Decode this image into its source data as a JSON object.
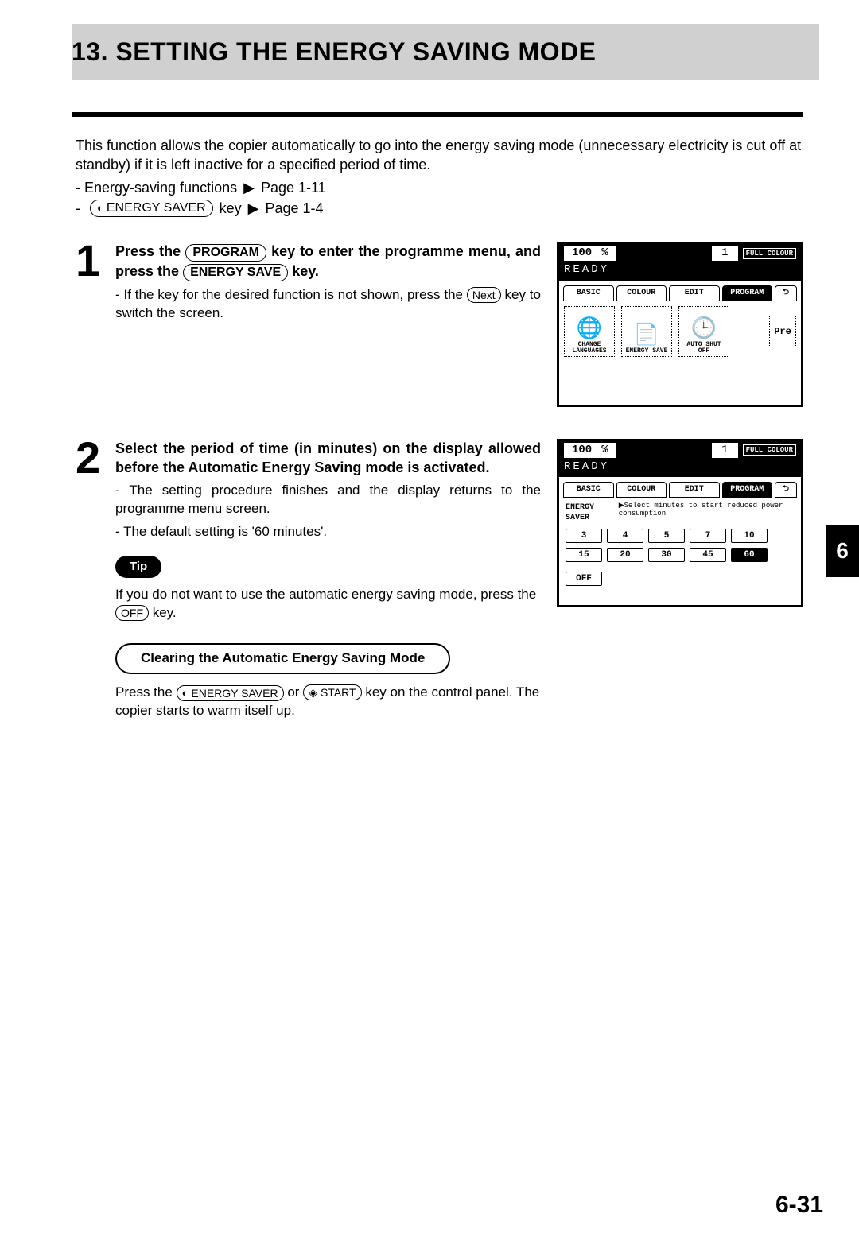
{
  "chapter": {
    "number": "13.",
    "title": "SETTING THE ENERGY SAVING MODE"
  },
  "intro": {
    "para": "This function allows the copier automatically to go into the energy saving mode (unnecessary electricity is cut off at standby) if it is left inactive for a specified period of time.",
    "ref1_prefix": "- Energy-saving functions",
    "ref1_page": "Page 1-11",
    "ref2_prefix": "-",
    "ref2_key": "ENERGY SAVER",
    "ref2_suffix": "key",
    "ref2_page": "Page 1-4"
  },
  "side_tab": "6",
  "page_number": "6-31",
  "steps": [
    {
      "num": "1",
      "heading_before": "Press the",
      "heading_key1": "PROGRAM",
      "heading_mid": "key to enter the programme menu, and press the",
      "heading_key2": "ENERGY SAVE",
      "heading_after": "key.",
      "bullet1_before": "- If the key for the desired function is not shown, press the",
      "bullet1_key": "Next",
      "bullet1_after": "key to switch the screen."
    },
    {
      "num": "2",
      "heading": "Select the period of time (in minutes) on the display allowed before the Automatic Energy Saving mode is activated.",
      "bullet1": "- The setting procedure finishes and the display returns to the programme menu screen.",
      "bullet2": "- The default setting is '60 minutes'.",
      "tip_label": "Tip",
      "tip_before": "If you do not want to use the automatic energy saving mode, press the",
      "tip_key": "OFF",
      "tip_after": "key.",
      "subhead": "Clearing the Automatic Energy Saving Mode",
      "clear_before": "Press the",
      "clear_key1": "ENERGY SAVER",
      "clear_mid": "or",
      "clear_key2": "START",
      "clear_after": "key on the control panel. The copier starts to warm itself up."
    }
  ],
  "panel_common": {
    "zoom": "100",
    "pct": "%",
    "count": "1",
    "full_colour": "FULL COLOUR",
    "ready": "READY",
    "tabs": [
      "BASIC",
      "COLOUR",
      "EDIT",
      "PROGRAM"
    ]
  },
  "panel1": {
    "options": [
      {
        "label": "CHANGE LANGUAGES",
        "icon": "🌐"
      },
      {
        "label": "ENERGY SAVE",
        "icon": "📄"
      },
      {
        "label": "AUTO SHUT OFF",
        "icon": "🕒"
      }
    ],
    "pre": "Pre"
  },
  "panel2": {
    "es_label": "ENERGY SAVER",
    "es_text": "▶Select minutes to start reduced power consumption",
    "minutes": [
      "3",
      "4",
      "5",
      "7",
      "10",
      "15",
      "20",
      "30",
      "45",
      "60"
    ],
    "off": "OFF",
    "selected": "60"
  }
}
